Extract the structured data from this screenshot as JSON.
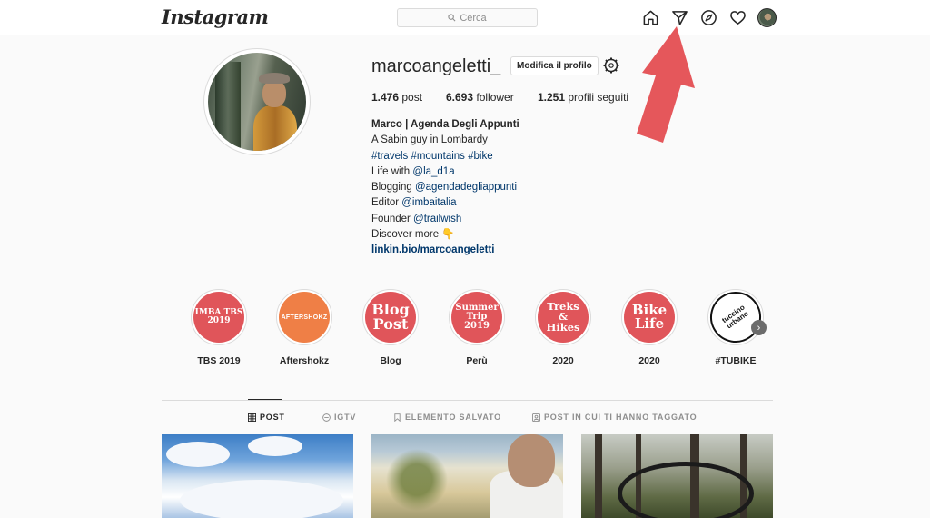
{
  "header": {
    "logo": "Instagram",
    "search_placeholder": "Cerca"
  },
  "profile": {
    "username": "marcoangeletti_",
    "edit_button": "Modifica il profilo",
    "stats": {
      "posts_count": "1.476",
      "posts_label": "post",
      "followers_count": "6.693",
      "followers_label": "follower",
      "following_count": "1.251",
      "following_label": "profili seguiti"
    },
    "bio": {
      "name": "Marco | Agenda Degli Appunti",
      "line1": "A Sabin guy in Lombardy",
      "hashtags": "#travels #mountains #bike",
      "life_prefix": "Life with ",
      "life_link": "@la_d1a",
      "blogging_prefix": "Blogging ",
      "blogging_link": "@agendadegliappunti",
      "editor_prefix": "Editor ",
      "editor_link": "@imbaitalia",
      "founder_prefix": "Founder ",
      "founder_link": "@trailwish",
      "discover": "Discover more 👇",
      "website": "linkin.bio/marcoangeletti_"
    }
  },
  "highlights": [
    {
      "cover_text": "IMBA TBS 2019",
      "label": "TBS 2019",
      "color": "#e0555a"
    },
    {
      "cover_text": "AFTERSHOKZ",
      "label": "Aftershokz",
      "color": "#ef7f46"
    },
    {
      "cover_text": "Blog Post",
      "label": "Blog",
      "color": "#e0555a"
    },
    {
      "cover_text": "Summer Trip 2019",
      "label": "Perù",
      "color": "#e0555a"
    },
    {
      "cover_text": "Treks & Hikes",
      "label": "2020",
      "color": "#e0555a"
    },
    {
      "cover_text": "Bike Life",
      "label": "2020",
      "color": "#e0555a"
    },
    {
      "cover_text": "tuccino urbano",
      "label": "#TUBIKE",
      "color": "#ffffff"
    }
  ],
  "tabs": {
    "post": "POST",
    "igtv": "IGTV",
    "saved": "ELEMENTO SALVATO",
    "tagged": "POST IN CUI TI HANNO TAGGATO"
  },
  "colors": {
    "accent_arrow": "#e5575b",
    "link": "#00376b"
  }
}
